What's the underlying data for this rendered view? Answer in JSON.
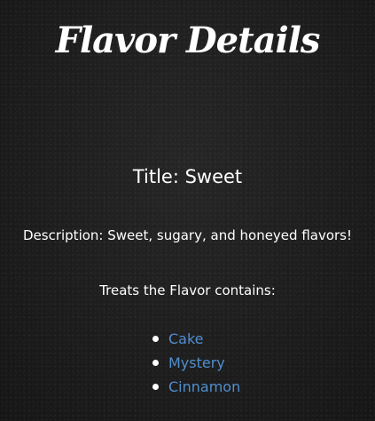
{
  "page": {
    "title": "Flavor Details"
  },
  "flavor": {
    "title_label": "Title: Sweet",
    "description_label": "Description: Sweet, sugary, and honeyed flavors!",
    "treats_heading": "Treats the Flavor contains:",
    "treats": [
      {
        "name": "Cake"
      },
      {
        "name": "Mystery"
      },
      {
        "name": "Cinnamon"
      }
    ]
  },
  "colors": {
    "background": "#1c1c1c",
    "text": "#ffffff",
    "link": "#4f8fce"
  }
}
